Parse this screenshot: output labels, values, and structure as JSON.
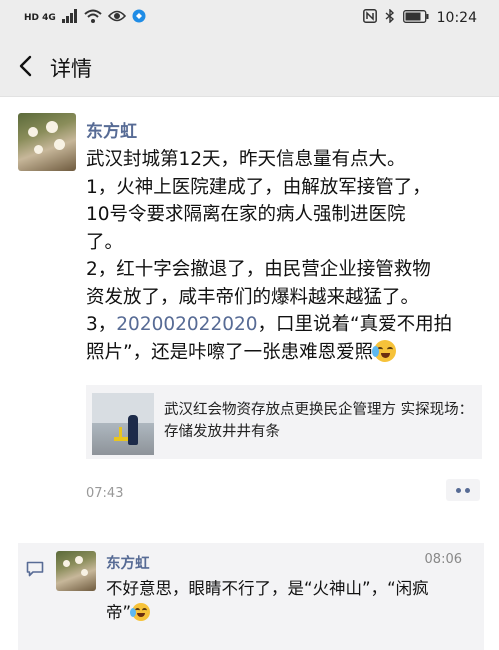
{
  "status_bar": {
    "network_label": "HD 4G",
    "signal_icon": "signal-icon",
    "wifi_icon": "wifi-icon",
    "eye_icon": "eye-comfort-icon",
    "app_icon": "app-notification-icon",
    "nfc_icon": "nfc-icon",
    "bluetooth_icon": "bluetooth-icon",
    "battery_icon": "battery-icon",
    "time": "10:24"
  },
  "nav": {
    "back_icon": "back-arrow-icon",
    "title": "详情"
  },
  "post": {
    "author": "东方虹",
    "lines": [
      "武汉封城第12天，昨天信息量有点大。",
      "1，火神上医院建成了，由解放军接管了，",
      "10号令要求隔离在家的病人强制进医院",
      "了。",
      "2，红十字会撤退了，由民营企业接管救物",
      "资发放了，咸丰帝们的爆料越来越猛了。"
    ],
    "line7_prefix": "3，",
    "line7_link": "202002022020",
    "line7_suffix": "，口里说着“真爱不用拍",
    "line8": "照片”，还是咔嚓了一张患难恩爱照",
    "emoji": "crying-laughing-emoji",
    "link_card": {
      "title": "武汉红会物资存放点更换民企管理方 实探现场：存储发放井井有条",
      "thumbnail": "warehouse-thumbnail"
    },
    "time": "07:43",
    "more_icon": "more-dots-icon"
  },
  "comments": [
    {
      "icon": "comment-icon",
      "author": "东方虹",
      "time": "08:06",
      "text_line1": "不好意思，眼睛不行了，是“火神山”，“闲疯",
      "text_line2": "帝”",
      "emoji": "crying-laughing-emoji"
    }
  ],
  "colors": {
    "link": "#576b95",
    "bar_bg": "#ededed",
    "panel_bg": "#f3f3f5"
  }
}
